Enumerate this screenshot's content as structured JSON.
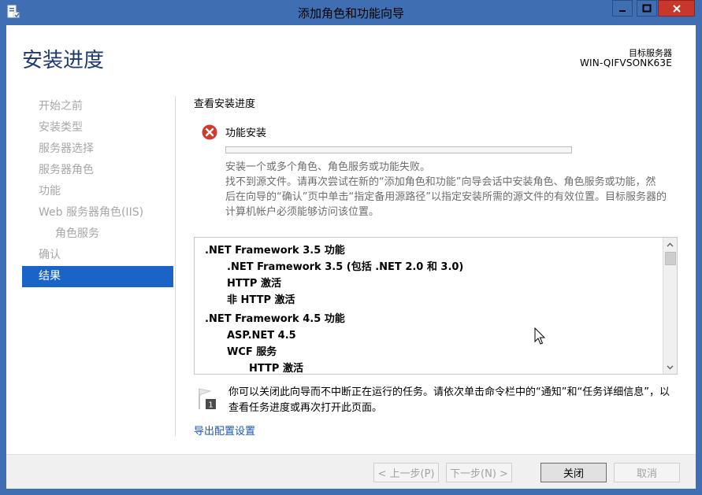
{
  "window": {
    "title": "添加角色和功能向导"
  },
  "header": {
    "page_title": "安装进度",
    "target_label": "目标服务器",
    "target_name": "WIN-QIFVSONK63E"
  },
  "nav": {
    "items": [
      {
        "label": "开始之前"
      },
      {
        "label": "安装类型"
      },
      {
        "label": "服务器选择"
      },
      {
        "label": "服务器角色"
      },
      {
        "label": "功能"
      },
      {
        "label": "Web 服务器角色(IIS)"
      },
      {
        "label": "角色服务"
      },
      {
        "label": "确认"
      },
      {
        "label": "结果"
      }
    ]
  },
  "main": {
    "section_head": "查看安装进度",
    "feature_title": "功能安装",
    "progress_fraction": 0,
    "error_lines": [
      "安装一个或多个角色、角色服务或功能失败。",
      "找不到源文件。请再次尝试在新的“添加角色和功能”向导会话中安装角色、角色服务或功能，然",
      "后在向导的“确认”页中单击“指定备用源路径”以指定安装所需的源文件的有效位置。目标服务器的",
      "计算机帐户必须能够访问该位置。"
    ],
    "list": [
      {
        "text": ".NET Framework 3.5 功能"
      },
      {
        "text": ".NET Framework 3.5 (包括 .NET 2.0 和 3.0)"
      },
      {
        "text": "HTTP 激活"
      },
      {
        "text": "非 HTTP 激活"
      },
      {
        "text": ".NET Framework 4.5 功能"
      },
      {
        "text": "ASP.NET 4.5"
      },
      {
        "text": "WCF 服务"
      },
      {
        "text": "HTTP 激活"
      }
    ],
    "note_lines": [
      "你可以关闭此向导而不中断正在运行的任务。请依次单击命令栏中的“通知”和“任务详细信息”，以",
      "查看任务进度或再次打开此页面。"
    ],
    "export_link": "导出配置设置"
  },
  "footer": {
    "prev_label": "< 上一步(P)",
    "next_label": "下一步(N) >",
    "close_label": "关闭",
    "cancel_label": "取消"
  },
  "colors": {
    "titlebar": "#3f6fb2",
    "nav_active": "#1b64c7",
    "link": "#1a56b8",
    "error": "#d13b2e"
  }
}
